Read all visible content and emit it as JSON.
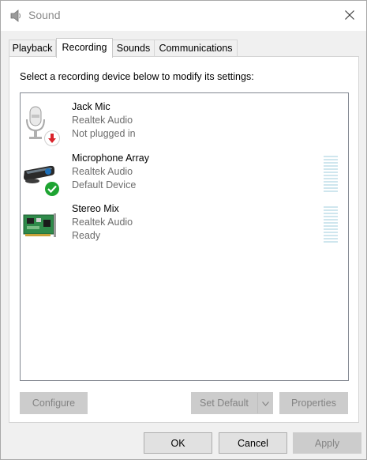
{
  "window": {
    "title": "Sound",
    "icon": "speaker-icon",
    "close_icon": "close-icon"
  },
  "tabs": [
    {
      "label": "Playback",
      "active": false
    },
    {
      "label": "Recording",
      "active": true
    },
    {
      "label": "Sounds",
      "active": false
    },
    {
      "label": "Communications",
      "active": false
    }
  ],
  "panel": {
    "instruction": "Select a recording device below to modify its settings:"
  },
  "devices": [
    {
      "name": "Jack Mic",
      "driver": "Realtek Audio",
      "status": "Not plugged in",
      "icon": "microphone-icon",
      "badge": "unplugged-arrow-icon",
      "level_meter": false
    },
    {
      "name": "Microphone Array",
      "driver": "Realtek Audio",
      "status": "Default Device",
      "icon": "microphone-array-icon",
      "badge": "default-check-icon",
      "level_meter": true
    },
    {
      "name": "Stereo Mix",
      "driver": "Realtek Audio",
      "status": "Ready",
      "icon": "sound-card-icon",
      "badge": null,
      "level_meter": true
    }
  ],
  "panel_buttons": {
    "configure": "Configure",
    "set_default": "Set Default",
    "properties": "Properties"
  },
  "dialog_buttons": {
    "ok": "OK",
    "cancel": "Cancel",
    "apply": "Apply"
  },
  "colors": {
    "accent_check": "#1ea432",
    "unplugged_arrow": "#d9232a",
    "level_meter": "#cfe6ee"
  }
}
